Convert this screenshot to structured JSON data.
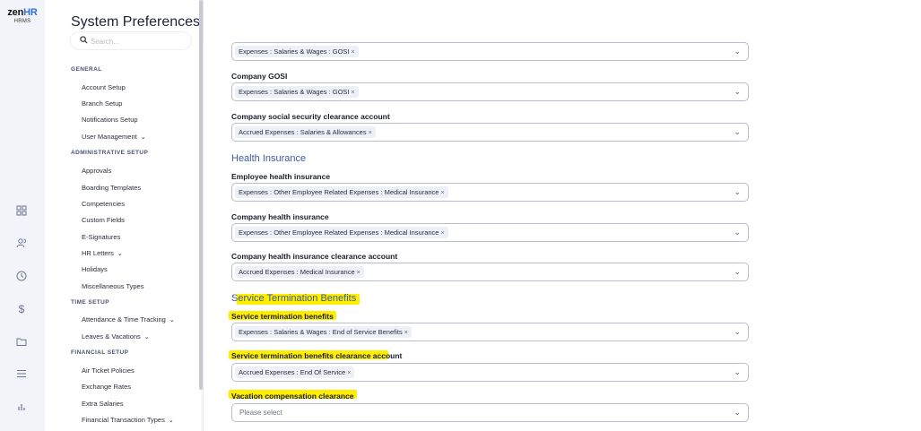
{
  "app": {
    "brand_main": "zen",
    "brand_accent": "HR",
    "brand_sub": "HRMS"
  },
  "rail_icons": [
    "grid-icon",
    "users-icon",
    "clock-icon",
    "dollar-icon",
    "folder-icon",
    "list-icon",
    "chart-icon"
  ],
  "prefs": {
    "title": "System Preferences",
    "search_placeholder": "Search...",
    "sections": {
      "general": "GENERAL",
      "administrative": "ADMINISTRATIVE SETUP",
      "time": "TIME SETUP",
      "financial": "FINANCIAL SETUP"
    },
    "items": {
      "account_setup": "Account Setup",
      "branch_setup": "Branch Setup",
      "notifications_setup": "Notifications Setup",
      "user_management": "User Management",
      "approvals": "Approvals",
      "boarding_templates": "Boarding Templates",
      "competencies": "Competencies",
      "custom_fields": "Custom Fields",
      "e_signatures": "E-Signatures",
      "hr_letters": "HR Letters",
      "holidays": "Holidays",
      "misc_types": "Miscellaneous Types",
      "attendance": "Attendance & Time Tracking",
      "leaves": "Leaves & Vacations",
      "air_ticket": "Air Ticket Policies",
      "exchange_rates": "Exchange Rates",
      "extra_salaries": "Extra Salaries",
      "financial_transaction_types": "Financial Transaction Types"
    }
  },
  "main": {
    "fields": {
      "employee_gosi_value": "Expenses : Salaries & Wages : GOSI",
      "company_gosi_label": "Company GOSI",
      "company_gosi_value": "Expenses : Salaries & Wages : GOSI",
      "company_ss_label": "Company social security clearance account",
      "company_ss_value": "Accrued Expenses : Salaries & Allowances",
      "health_heading": "Health Insurance",
      "emp_health_label": "Employee health insurance",
      "emp_health_value": "Expenses : Other Employee Related Expenses : Medical Insurance",
      "co_health_label": "Company health insurance",
      "co_health_value": "Expenses : Other Employee Related Expenses : Medical Insurance",
      "co_health_clear_label": "Company health insurance clearance account",
      "co_health_clear_value": "Accrued Expenses : Medical Insurance",
      "stb_heading": "Service Termination Benefits",
      "stb_label": "Service termination benefits",
      "stb_value": "Expenses : Salaries & Wages : End of Service Benefits",
      "stb_clear_label": "Service termination benefits clearance account",
      "stb_clear_value": "Accrued Expenses : End Of Service",
      "vac_label": "Vacation compensation clearance",
      "vac_placeholder": "Please select"
    },
    "remove_glyph": "×",
    "highlight_color": "#ffee00"
  }
}
